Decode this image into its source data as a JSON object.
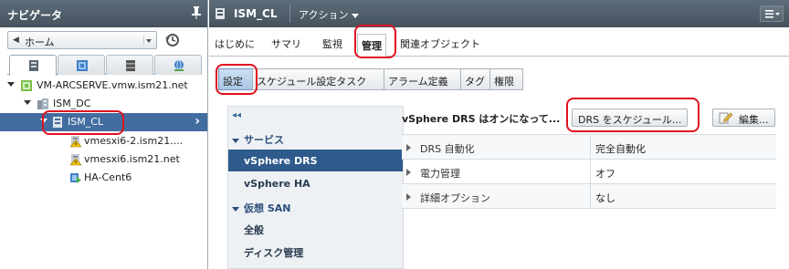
{
  "navigator": {
    "title": "ナビゲータ",
    "home_label": "ホーム",
    "tabs": [
      {
        "icon": "hosts-clusters-icon"
      },
      {
        "icon": "vms-templates-icon"
      },
      {
        "icon": "storage-icon"
      },
      {
        "icon": "networking-icon"
      }
    ],
    "tree": [
      {
        "label": "VM-ARCSERVE.vmw.ism21.net",
        "icon": "vcenter-icon",
        "expanded": true
      },
      {
        "label": "ISM_DC",
        "icon": "datacenter-icon",
        "expanded": true
      },
      {
        "label": "ISM_CL",
        "icon": "cluster-icon",
        "expanded": true,
        "selected": true
      },
      {
        "label": "vmesxi6-2.ism21....",
        "icon": "host-warning-icon"
      },
      {
        "label": "vmesxi6.ism21.net",
        "icon": "host-warning-icon"
      },
      {
        "label": "HA-Cent6",
        "icon": "vm-powered-on-icon"
      }
    ]
  },
  "object": {
    "title": "ISM_CL",
    "actions_label": "アクション",
    "tabs": [
      {
        "label": "はじめに"
      },
      {
        "label": "サマリ"
      },
      {
        "label": "監視"
      },
      {
        "label": "管理",
        "active": true
      },
      {
        "label": "関連オブジェクト"
      }
    ],
    "subtabs": [
      {
        "label": "設定",
        "active": true
      },
      {
        "label": "スケジュール設定タスク"
      },
      {
        "label": "アラーム定義"
      },
      {
        "label": "タグ"
      },
      {
        "label": "権限"
      }
    ]
  },
  "settings_nav": {
    "groups": [
      {
        "label": "サービス",
        "items": [
          {
            "label": "vSphere DRS",
            "selected": true
          },
          {
            "label": "vSphere HA"
          }
        ]
      },
      {
        "label": "仮想 SAN",
        "items": [
          {
            "label": "全般"
          },
          {
            "label": "ディスク管理"
          }
        ]
      }
    ]
  },
  "content": {
    "status": "vSphere DRS はオンになって...",
    "schedule_button": "DRS をスケジュール...",
    "edit_button": "編集...",
    "properties": [
      {
        "name": "DRS 自動化",
        "value": "完全自動化"
      },
      {
        "name": "電力管理",
        "value": "オフ"
      },
      {
        "name": "詳細オプション",
        "value": "なし"
      }
    ]
  },
  "colors": {
    "header_bg": "#45525e",
    "selection": "#436da0",
    "annotation_red": "#e0121f"
  }
}
